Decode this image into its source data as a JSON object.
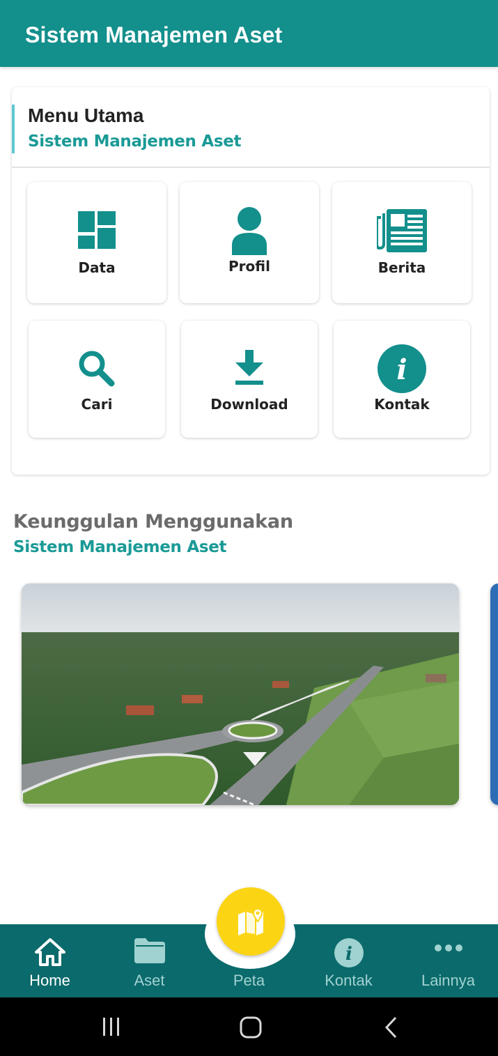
{
  "appbar": {
    "title": "Sistem Manajemen Aset"
  },
  "menu": {
    "title": "Menu Utama",
    "subtitle": "Sistem Manajemen Aset",
    "items": [
      {
        "label": "Data",
        "icon": "grid-icon"
      },
      {
        "label": "Profil",
        "icon": "person-icon"
      },
      {
        "label": "Berita",
        "icon": "newspaper-icon"
      },
      {
        "label": "Cari",
        "icon": "search-icon"
      },
      {
        "label": "Download",
        "icon": "download-icon"
      },
      {
        "label": "Kontak",
        "icon": "info-icon"
      }
    ]
  },
  "advantages": {
    "title": "Keunggulan Menggunakan",
    "subtitle": "Sistem Manajemen Aset"
  },
  "bottom_nav": {
    "items": [
      {
        "label": "Home",
        "icon": "home-icon",
        "active": true
      },
      {
        "label": "Aset",
        "icon": "folder-icon",
        "active": false
      },
      {
        "label": "Peta",
        "icon": "map-icon",
        "active": false
      },
      {
        "label": "Kontak",
        "icon": "info-icon",
        "active": false
      },
      {
        "label": "Lainnya",
        "icon": "more-icon",
        "active": false
      }
    ]
  },
  "system_nav": {
    "buttons": [
      "recents-icon",
      "home-button-icon",
      "back-icon"
    ]
  },
  "colors": {
    "primary": "#138f8c",
    "nav_background": "#0b6a6b",
    "accent_text": "#1a9a96",
    "fab": "#fbd514"
  }
}
